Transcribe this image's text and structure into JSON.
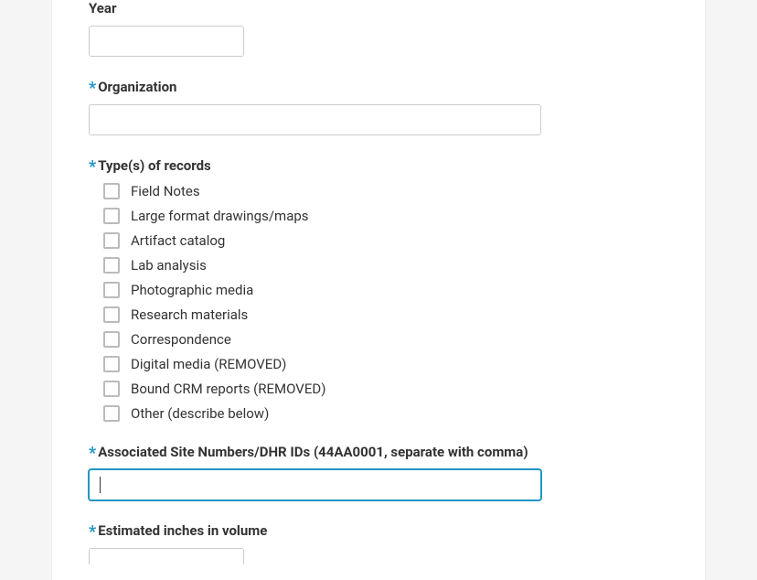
{
  "fields": {
    "year": {
      "label": "Year",
      "value": "",
      "required": false
    },
    "organization": {
      "label": "Organization",
      "value": "",
      "required": true
    },
    "recordTypes": {
      "label": "Type(s) of records",
      "required": true,
      "options": [
        {
          "label": "Field Notes",
          "checked": false
        },
        {
          "label": "Large format drawings/maps",
          "checked": false
        },
        {
          "label": "Artifact catalog",
          "checked": false
        },
        {
          "label": "Lab analysis",
          "checked": false
        },
        {
          "label": "Photographic media",
          "checked": false
        },
        {
          "label": "Research materials",
          "checked": false
        },
        {
          "label": "Correspondence",
          "checked": false
        },
        {
          "label": "Digital media (REMOVED)",
          "checked": false
        },
        {
          "label": "Bound CRM reports (REMOVED)",
          "checked": false
        },
        {
          "label": "Other (describe below)",
          "checked": false
        }
      ]
    },
    "siteNumbers": {
      "label": "Associated Site Numbers/DHR IDs (44AA0001, separate with comma)",
      "value": "",
      "required": true
    },
    "estimatedInches": {
      "label": "Estimated inches in volume",
      "value": "",
      "required": true
    }
  },
  "requiredMark": "*"
}
